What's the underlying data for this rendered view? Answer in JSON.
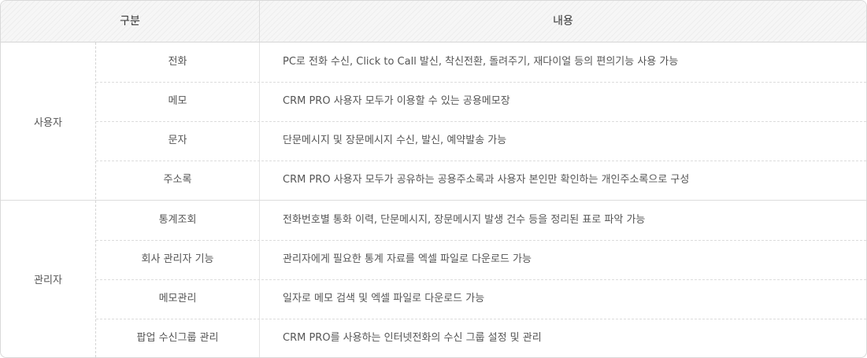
{
  "header": {
    "col1": "구분",
    "col2": "내용"
  },
  "groups": [
    {
      "label": "사용자",
      "rows": [
        {
          "sub": "전화",
          "desc": "PC로 전화 수신, Click to Call 발신, 착신전환, 돌려주기, 재다이얼 등의 편의기능 사용 가능"
        },
        {
          "sub": "메모",
          "desc": "CRM PRO 사용자 모두가 이용할 수 있는 공용메모장"
        },
        {
          "sub": "문자",
          "desc": "단문메시지 및 장문메시지 수신, 발신, 예약발송 가능"
        },
        {
          "sub": "주소록",
          "desc": "CRM PRO 사용자 모두가 공유하는 공용주소록과 사용자 본인만 확인하는 개인주소록으로 구성"
        }
      ]
    },
    {
      "label": "관리자",
      "rows": [
        {
          "sub": "통계조회",
          "desc": "전화번호별 통화 이력, 단문메시지, 장문메시지 발생 건수 등을 정리된 표로 파악 가능"
        },
        {
          "sub": "회사 관리자 기능",
          "desc": "관리자에게 필요한 통계 자료를 엑셀 파일로 다운로드 가능"
        },
        {
          "sub": "메모관리",
          "desc": "일자로 메모 검색 및 엑셀 파일로 다운로드 가능"
        },
        {
          "sub": "팝업 수신그룹 관리",
          "desc": "CRM PRO를 사용하는 인터넷전화의 수신 그룹 설정 및 관리"
        }
      ]
    }
  ]
}
